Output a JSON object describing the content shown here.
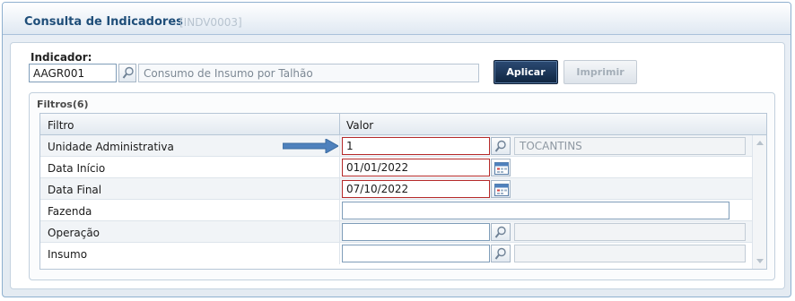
{
  "header": {
    "title": "Consulta de Indicadores",
    "code": "[INDV0003]"
  },
  "indicador": {
    "label": "Indicador:",
    "code": "AAGR001",
    "description": "Consumo de Insumo por Talhão"
  },
  "buttons": {
    "apply": "Aplicar",
    "print": "Imprimir"
  },
  "filters": {
    "title": "Filtros(6)",
    "columns": {
      "filter": "Filtro",
      "value": "Valor"
    },
    "rows": [
      {
        "label": "Unidade Administrativa",
        "value": "1",
        "description": "TOCANTINS"
      },
      {
        "label": "Data Início",
        "value": "01/01/2022"
      },
      {
        "label": "Data Final",
        "value": "07/10/2022"
      },
      {
        "label": "Fazenda",
        "value": ""
      },
      {
        "label": "Operação",
        "value": "",
        "description": ""
      },
      {
        "label": "Insumo",
        "value": "",
        "description": ""
      }
    ]
  },
  "colors": {
    "required_border": "#b62a2a",
    "arrow": "#4f81bd",
    "apply_bg": "#1a3558"
  },
  "icons": [
    "search-icon",
    "calendar-icon",
    "arrow-right-icon",
    "scroll-up-icon",
    "scroll-down-icon"
  ]
}
